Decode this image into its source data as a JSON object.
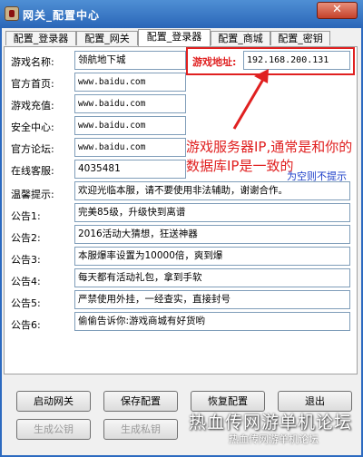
{
  "window": {
    "title": "网关_配置中心",
    "close_label": "✕"
  },
  "tabs": [
    {
      "label": "配置_登录器"
    },
    {
      "label": "配置_网关"
    },
    {
      "label": "配置_登录器"
    },
    {
      "label": "配置_商城"
    },
    {
      "label": "配置_密钥"
    }
  ],
  "active_tab": "配置_登录器",
  "form": {
    "game_name": {
      "label": "游戏名称:",
      "value": "领航地下城"
    },
    "home_url": {
      "label": "官方首页:",
      "value": "www.baidu.com"
    },
    "recharge_url": {
      "label": "游戏充值:",
      "value": "www.baidu.com"
    },
    "security_url": {
      "label": "安全中心:",
      "value": "www.baidu.com"
    },
    "forum_url": {
      "label": "官方论坛:",
      "value": "www.baidu.com"
    },
    "support_qq": {
      "label": "在线客服:",
      "value": "4035481"
    },
    "game_addr": {
      "label": "游戏地址:",
      "value": "192.168.200.131"
    },
    "tip": {
      "label": "温馨提示:",
      "value": "欢迎光临本服，请不要使用非法辅助，谢谢合作。"
    },
    "notices": [
      {
        "label": "公告1:",
        "value": "完美85级，升级快到离谱"
      },
      {
        "label": "公告2:",
        "value": "2016活动大猜想，狂送神器"
      },
      {
        "label": "公告3:",
        "value": "本服爆率设置为10000倍，爽到爆"
      },
      {
        "label": "公告4:",
        "value": "每天都有活动礼包，拿到手软"
      },
      {
        "label": "公告5:",
        "value": "严禁使用外挂，一经查实，直接封号"
      },
      {
        "label": "公告6:",
        "value": "偷偷告诉你:游戏商城有好货哟"
      }
    ]
  },
  "annotation": {
    "note": "游戏服务器IP,通常是和你的数据库IP是一致的",
    "empty_hint": "为空则不提示"
  },
  "buttons": {
    "start": "启动网关",
    "save": "保存配置",
    "restore": "恢复配置",
    "exit": "退出",
    "gen_public": "生成公钥",
    "gen_private": "生成私钥"
  },
  "watermark": {
    "line1": "热血传网游单机论坛",
    "line2": "热血传网游单机论坛"
  },
  "colors": {
    "annotation": "#e02020",
    "hint": "#1a3cc8",
    "titlebar": "#2a66b8"
  }
}
